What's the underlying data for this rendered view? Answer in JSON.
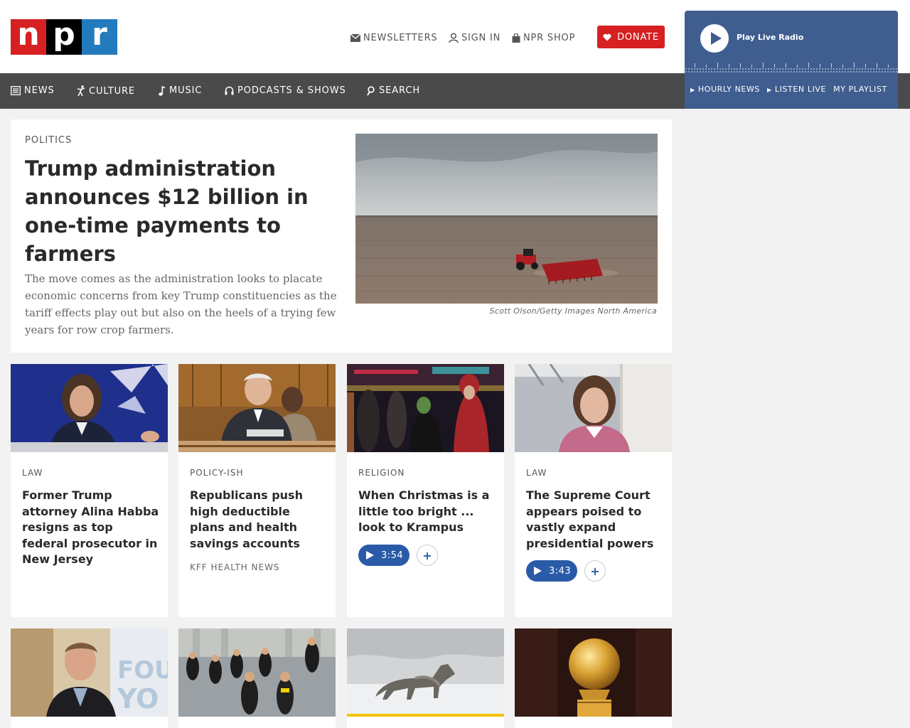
{
  "logo": {
    "letters": [
      "n",
      "p",
      "r"
    ]
  },
  "utility": {
    "newsletters": "NEWSLETTERS",
    "sign_in": "SIGN IN",
    "shop": "NPR SHOP",
    "donate": "DONATE"
  },
  "radio": {
    "play_label": "Play Live Radio",
    "links": [
      "HOURLY NEWS",
      "LISTEN LIVE",
      "MY PLAYLIST"
    ]
  },
  "nav": {
    "items": [
      {
        "label": "NEWS",
        "icon": "news-icon"
      },
      {
        "label": "CULTURE",
        "icon": "culture-icon"
      },
      {
        "label": "MUSIC",
        "icon": "music-note-icon"
      },
      {
        "label": "PODCASTS & SHOWS",
        "icon": "headphones-icon"
      },
      {
        "label": "SEARCH",
        "icon": "search-icon"
      }
    ]
  },
  "hero": {
    "slug": "POLITICS",
    "headline": "Trump administration announces $12 billion in one-time payments to farmers",
    "teaser": "The move comes as the administration looks to placate economic concerns from key Trump constituencies as the tariff effects play out but also on the heels of a trying few years for row crop farmers.",
    "credit": "Scott Olson/Getty Images North America"
  },
  "stories": [
    {
      "slug": "LAW",
      "title": "Former Trump attorney Alina Habba resigns as top federal prosecutor in New Jersey"
    },
    {
      "slug": "POLICY-ISH",
      "title": "Republicans push high deductible plans and health savings accounts",
      "source": "KFF HEALTH NEWS"
    },
    {
      "slug": "RELIGION",
      "title": "When Christmas is a little too bright ... look to Krampus",
      "duration": "3:54"
    },
    {
      "slug": "LAW",
      "title": "The Supreme Court appears poised to vastly expand presidential powers",
      "duration": "3:43"
    }
  ],
  "add_symbol": "+",
  "colors": {
    "brand_red": "#d62021",
    "brand_blue": "#237bbd",
    "nav_bg": "#4a4a4a",
    "radio_bg": "#3f5e8f",
    "audio_blue": "#2a5ba8"
  }
}
